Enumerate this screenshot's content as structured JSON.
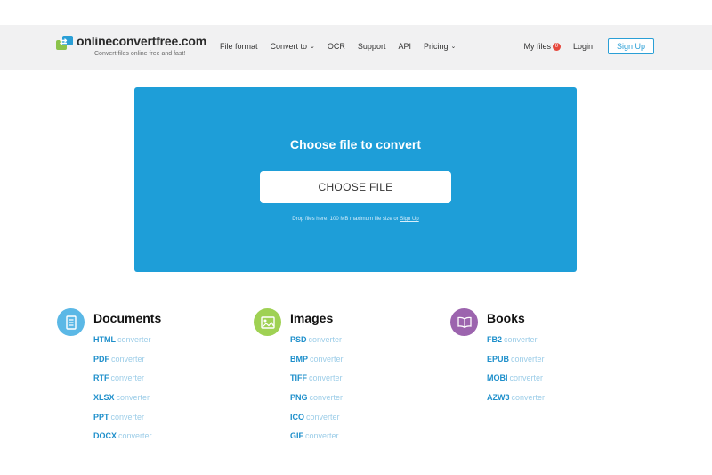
{
  "header": {
    "site_name": "onlineconvertfree.com",
    "tagline": "Convert files online free and fast!",
    "nav": [
      {
        "label": "File format",
        "has_caret": false
      },
      {
        "label": "Convert to",
        "has_caret": true
      },
      {
        "label": "OCR",
        "has_caret": false
      },
      {
        "label": "Support",
        "has_caret": false
      },
      {
        "label": "API",
        "has_caret": false
      },
      {
        "label": "Pricing",
        "has_caret": true
      }
    ],
    "my_files_label": "My files",
    "my_files_count": "0",
    "login_label": "Login",
    "signup_label": "Sign Up"
  },
  "upload": {
    "title": "Choose file to convert",
    "button_label": "CHOOSE FILE",
    "note_text": "Drop files here. 100 MB maximum file size or",
    "note_link": "Sign Up"
  },
  "categories": [
    {
      "title": "Documents",
      "icon": "document-icon",
      "color": "#5bb8e6",
      "links": [
        {
          "format": "HTML",
          "suffix": "converter"
        },
        {
          "format": "PDF",
          "suffix": "converter"
        },
        {
          "format": "RTF",
          "suffix": "converter"
        },
        {
          "format": "XLSX",
          "suffix": "converter"
        },
        {
          "format": "PPT",
          "suffix": "converter"
        },
        {
          "format": "DOCX",
          "suffix": "converter"
        }
      ]
    },
    {
      "title": "Images",
      "icon": "image-icon",
      "color": "#9fd153",
      "links": [
        {
          "format": "PSD",
          "suffix": "converter"
        },
        {
          "format": "BMP",
          "suffix": "converter"
        },
        {
          "format": "TIFF",
          "suffix": "converter"
        },
        {
          "format": "PNG",
          "suffix": "converter"
        },
        {
          "format": "ICO",
          "suffix": "converter"
        },
        {
          "format": "GIF",
          "suffix": "converter"
        }
      ]
    },
    {
      "title": "Books",
      "icon": "book-icon",
      "color": "#9c64ae",
      "links": [
        {
          "format": "FB2",
          "suffix": "converter"
        },
        {
          "format": "EPUB",
          "suffix": "converter"
        },
        {
          "format": "MOBI",
          "suffix": "converter"
        },
        {
          "format": "AZW3",
          "suffix": "converter"
        }
      ]
    }
  ],
  "colors": {
    "accent": "#2a9fd6",
    "upload_bg": "#1e9ed8",
    "header_bg": "#f1f1f2",
    "badge": "#e6483d"
  }
}
